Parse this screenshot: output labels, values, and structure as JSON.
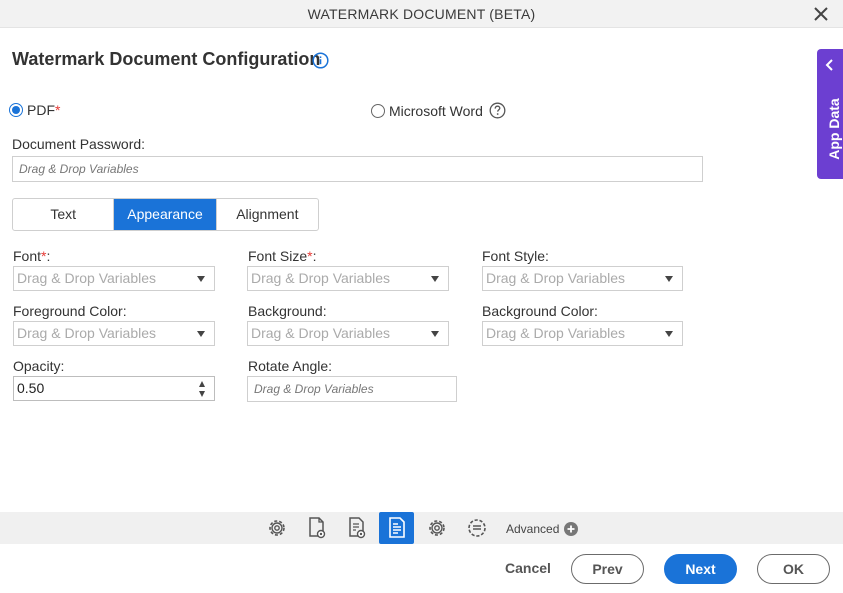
{
  "window": {
    "title": "WATERMARK DOCUMENT (BETA)"
  },
  "page": {
    "heading": "Watermark Document Configuration"
  },
  "format": {
    "pdf_label": "PDF",
    "pdf_required": "*",
    "pdf_selected": true,
    "word_label": "Microsoft Word"
  },
  "password": {
    "label": "Document Password:",
    "placeholder": "Drag & Drop Variables"
  },
  "tabs": [
    {
      "label": "Text",
      "active": false
    },
    {
      "label": "Appearance",
      "active": true
    },
    {
      "label": "Alignment",
      "active": false
    }
  ],
  "fields": {
    "font": {
      "label": "Font",
      "required": "*",
      "suffix": ":",
      "value": "Drag & Drop Variables"
    },
    "font_size": {
      "label": "Font Size",
      "required": "*",
      "suffix": ":",
      "value": "Drag & Drop Variables"
    },
    "font_style": {
      "label": "Font Style:",
      "value": "Drag & Drop Variables"
    },
    "foreground_color": {
      "label": "Foreground Color:",
      "value": "Drag & Drop Variables"
    },
    "background": {
      "label": "Background:",
      "value": "Drag & Drop Variables"
    },
    "background_color": {
      "label": "Background Color:",
      "value": "Drag & Drop Variables"
    },
    "opacity": {
      "label": "Opacity:",
      "value": "0.50"
    },
    "rotate_angle": {
      "label": "Rotate Angle:",
      "placeholder": "Drag & Drop Variables"
    }
  },
  "side_panel": {
    "label": "App Data"
  },
  "toolbar": {
    "icons": [
      "gear-icon",
      "document-settings-icon",
      "document-list-settings-icon",
      "document-active-icon",
      "gear-icon",
      "list-settings-icon"
    ],
    "advanced_label": "Advanced"
  },
  "footer": {
    "cancel": "Cancel",
    "prev": "Prev",
    "next": "Next",
    "ok": "OK"
  },
  "colors": {
    "accent": "#1a73d8",
    "side_panel": "#6c3fd1",
    "required": "#e53935"
  }
}
